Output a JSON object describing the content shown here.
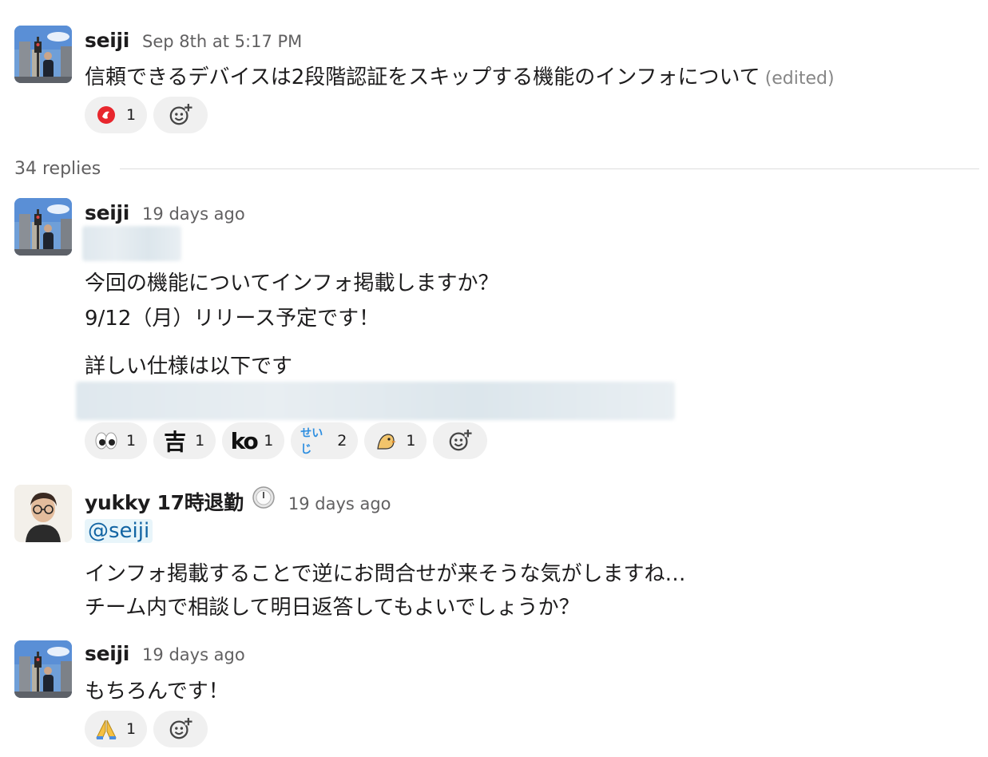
{
  "thread": {
    "parent": {
      "author": "seiji",
      "time": "Sep 8th at 5:17 PM",
      "text": "信頼できるデバイスは2段階認証をスキップする機能のインフォについて",
      "edited": "(edited)",
      "reactions": [
        {
          "icon": "red-brand-emoji",
          "count": "1"
        }
      ]
    },
    "replies_label": "34 replies",
    "replies": [
      {
        "author": "seiji",
        "time": "19 days ago",
        "lines": [
          "今回の機能についてインフォ掲載しますか？",
          "9/12（月）リリース予定です！",
          "詳しい仕様は以下です"
        ],
        "reactions": [
          {
            "icon": "eyes-emoji",
            "count": "1"
          },
          {
            "icon": "kichi-emoji",
            "label": "吉",
            "count": "1"
          },
          {
            "icon": "ko-emoji",
            "label": "ko",
            "count": "1"
          },
          {
            "icon": "seiji-emoji",
            "label": "せいじ",
            "count": "2"
          },
          {
            "icon": "bird-emoji",
            "count": "1"
          }
        ]
      },
      {
        "author": "yukky 17時退勤",
        "time": "19 days ago",
        "mention": "@seiji",
        "lines": [
          "インフォ掲載することで逆にお問合せが来そうな気がしますね…",
          "チーム内で相談して明日返答してもよいでしょうか？"
        ]
      },
      {
        "author": "seiji",
        "time": "19 days ago",
        "lines": [
          "もちろんです！"
        ],
        "reactions": [
          {
            "icon": "pray-emoji",
            "count": "1"
          }
        ]
      }
    ]
  },
  "colors": {
    "link": "#1264a3",
    "mention_bg": "#e8f5fa",
    "reaction_bg": "#f0f0f0",
    "muted": "#616061"
  }
}
